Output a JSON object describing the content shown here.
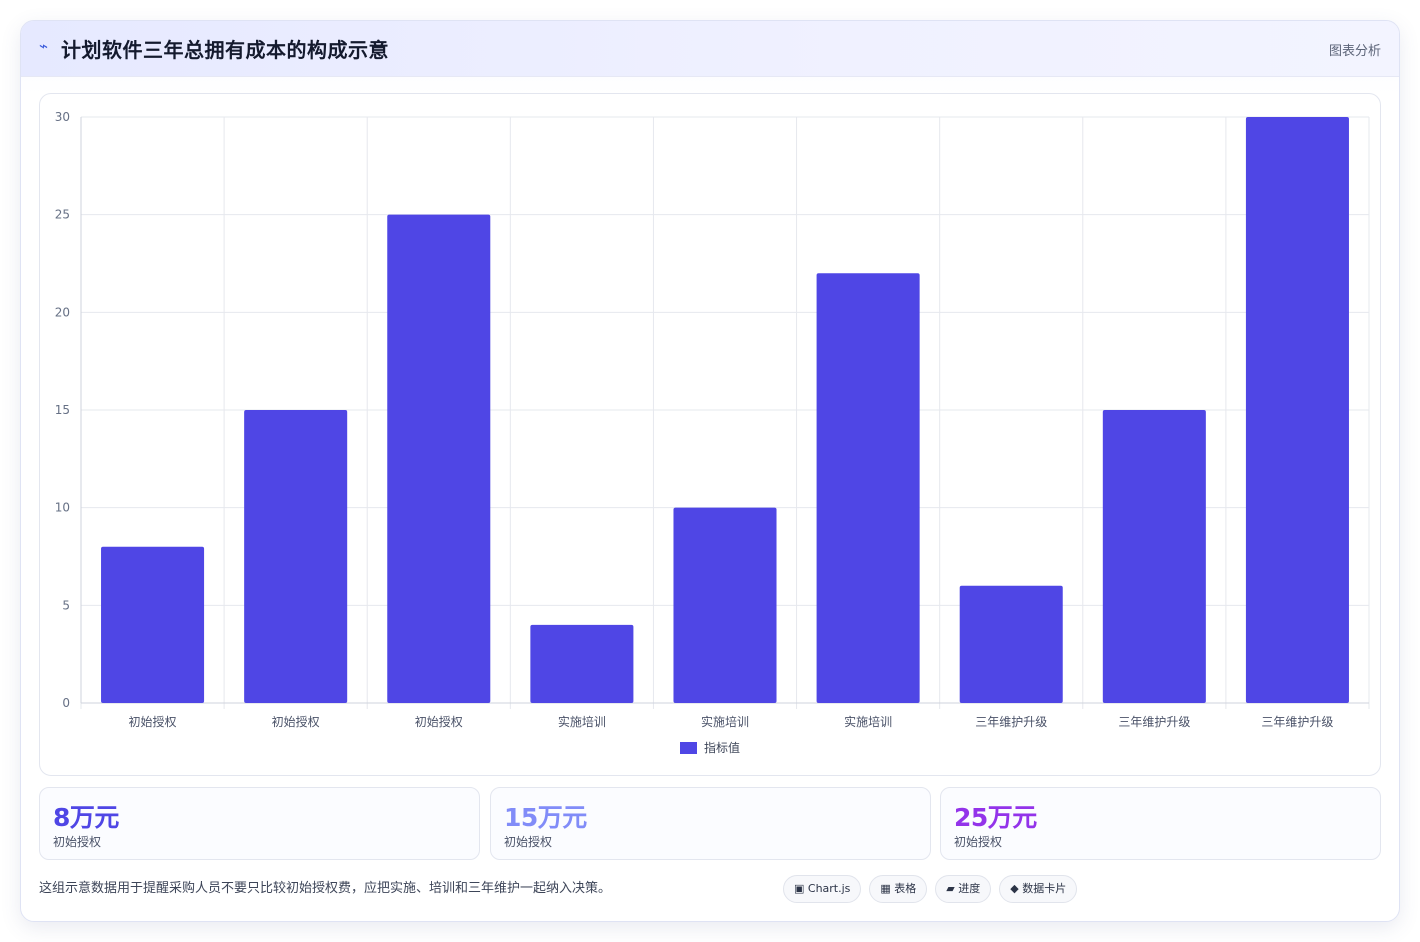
{
  "header": {
    "icon": "bolt-icon",
    "title": "计划软件三年总拥有成本的构成示意",
    "subtitle": "图表分析"
  },
  "chart_data": {
    "type": "bar",
    "categories": [
      "初始授权",
      "初始授权",
      "初始授权",
      "实施培训",
      "实施培训",
      "实施培训",
      "三年维护升级",
      "三年维护升级",
      "三年维护升级"
    ],
    "series": [
      {
        "name": "指标值",
        "values": [
          8,
          15,
          25,
          4,
          10,
          22,
          6,
          15,
          30
        ],
        "color": "#4f46e5"
      }
    ],
    "ylim": [
      0,
      30
    ],
    "yticks": [
      0,
      5,
      10,
      15,
      20,
      25,
      30
    ],
    "grid": true,
    "legend": "bottom-center"
  },
  "stats": [
    {
      "value": "8万元",
      "label": "初始授权",
      "color": "#4f46e5"
    },
    {
      "value": "15万元",
      "label": "初始授权",
      "color": "#818cf8"
    },
    {
      "value": "25万元",
      "label": "初始授权",
      "color": "#9333ea"
    }
  ],
  "note": "这组示意数据用于提醒采购人员不要只比较初始授权费，应把实施、培训和三年维护一起纳入决策。",
  "tags": [
    {
      "icon": "chart-square-icon",
      "label": "▣ Chart.js"
    },
    {
      "icon": "table-icon",
      "label": "▦ 表格"
    },
    {
      "icon": "progress-icon",
      "label": "▰ 进度"
    },
    {
      "icon": "diamond-icon",
      "label": "◆ 数据卡片"
    }
  ]
}
